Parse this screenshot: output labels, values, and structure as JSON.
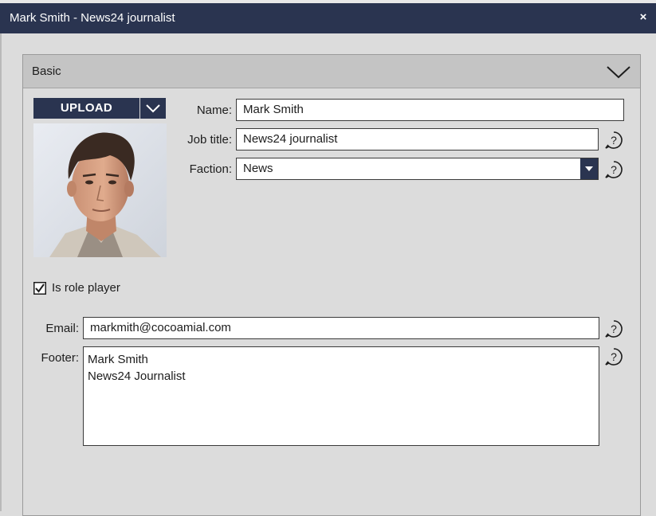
{
  "window": {
    "title": "Mark Smith - News24 journalist",
    "close_glyph": "×"
  },
  "panel": {
    "title": "Basic",
    "collapse_icon": "chevron-down-icon"
  },
  "photo": {
    "upload_label": "UPLOAD",
    "dropdown_icon": "chevron-down-icon"
  },
  "fields": {
    "name_label": "Name:",
    "name_value": "Mark Smith",
    "job_title_label": "Job title:",
    "job_title_value": "News24 journalist",
    "faction_label": "Faction:",
    "faction_value": "News",
    "email_label": "Email:",
    "email_value": "markmith@cocoamial.com",
    "footer_label": "Footer:",
    "footer_value": "Mark Smith\nNews24 Journalist"
  },
  "role_player": {
    "label": "Is role player",
    "checked": true
  },
  "colors": {
    "titlebar": "#2a3450",
    "panel_header": "#c4c4c4",
    "background": "#dcdcdc"
  }
}
